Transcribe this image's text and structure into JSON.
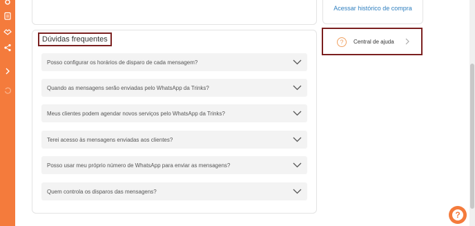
{
  "history": {
    "link_label": "Acessar histórico de compra"
  },
  "faq": {
    "title": "Dúvidas frequentes",
    "items": [
      {
        "label": "Posso configurar os horários de disparo de cada mensagem?"
      },
      {
        "label": "Quando as mensagens serão enviadas pelo WhatsApp da Trinks?"
      },
      {
        "label": "Meus clientes podem agendar novos serviços pelo WhatsApp da Trinks?"
      },
      {
        "label": "Terei acesso às mensagens enviadas aos clientes?"
      },
      {
        "label": "Posso usar meu próprio número de WhatsApp para enviar as mensagens?"
      },
      {
        "label": "Quem controla os disparos das mensagens?"
      }
    ]
  },
  "help": {
    "label": "Central de ajuda",
    "icon": "question-circle-icon"
  },
  "fab": {
    "glyph": "?"
  },
  "colors": {
    "accent": "#f47b3c",
    "link": "#2f7fbf",
    "highlight": "#7a1f1f"
  }
}
